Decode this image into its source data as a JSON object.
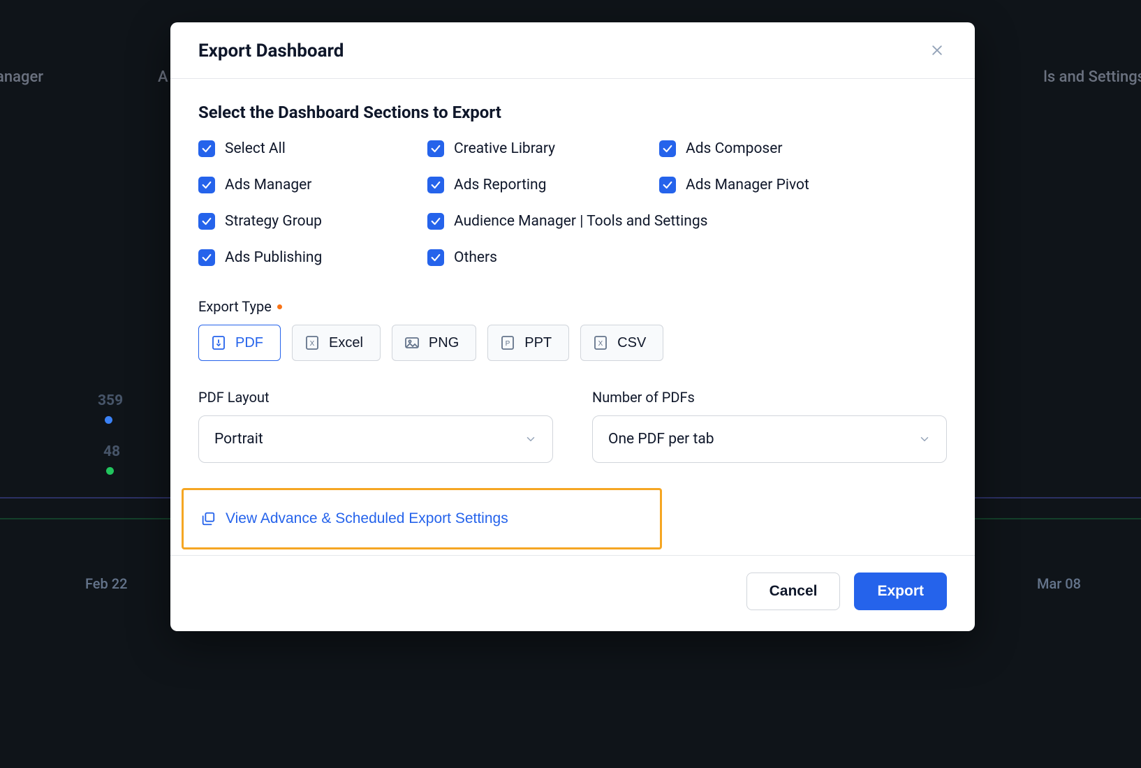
{
  "background": {
    "tabs_left_partial": "s Manager",
    "tabs_a_partial": "A",
    "tabs_right_partial": "ls and Settings",
    "point_359": "359",
    "point_48": "48",
    "date_left": "Feb 22",
    "date_right": "Mar 08"
  },
  "modal": {
    "title": "Export Dashboard",
    "section_title": "Select the Dashboard Sections to Export",
    "checkboxes": [
      {
        "label": "Select All",
        "checked": true
      },
      {
        "label": "Creative Library",
        "checked": true
      },
      {
        "label": "Ads Composer",
        "checked": true
      },
      {
        "label": "Ads Manager",
        "checked": true
      },
      {
        "label": "Ads Reporting",
        "checked": true
      },
      {
        "label": "Ads Manager Pivot",
        "checked": true
      },
      {
        "label": "Strategy Group",
        "checked": true
      },
      {
        "label": "Audience Manager | Tools and Settings",
        "checked": true,
        "span2": true
      },
      {
        "label": "Ads Publishing",
        "checked": true
      },
      {
        "label": "Others",
        "checked": true
      }
    ],
    "export_type_label": "Export Type",
    "export_types": [
      {
        "label": "PDF",
        "icon": "pdf-icon",
        "selected": true
      },
      {
        "label": "Excel",
        "icon": "excel-icon",
        "selected": false
      },
      {
        "label": "PNG",
        "icon": "image-icon",
        "selected": false
      },
      {
        "label": "PPT",
        "icon": "ppt-icon",
        "selected": false
      },
      {
        "label": "CSV",
        "icon": "csv-icon",
        "selected": false
      }
    ],
    "pdf_layout": {
      "label": "PDF Layout",
      "value": "Portrait"
    },
    "num_pdfs": {
      "label": "Number of PDFs",
      "value": "One PDF per tab"
    },
    "advanced_link": "View Advance & Scheduled Export Settings",
    "footer": {
      "cancel": "Cancel",
      "export": "Export"
    }
  }
}
